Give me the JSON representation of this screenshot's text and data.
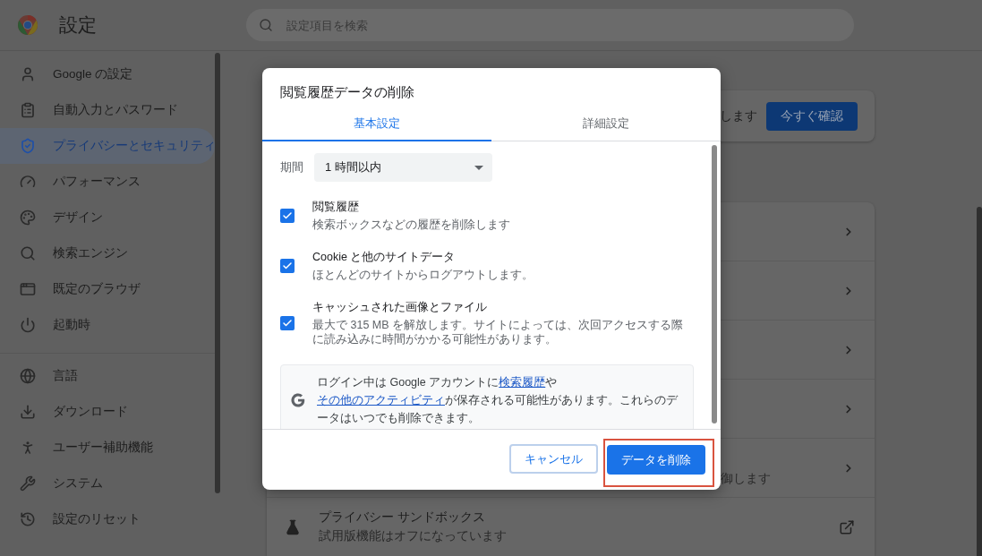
{
  "header": {
    "title": "設定",
    "search": {
      "placeholder": "設定項目を検索"
    }
  },
  "sidebar": {
    "groups": [
      [
        {
          "label": "Google の設定",
          "selected": false
        },
        {
          "label": "自動入力とパスワード",
          "selected": false
        },
        {
          "label": "プライバシーとセキュリティ",
          "selected": true
        },
        {
          "label": "パフォーマンス",
          "selected": false
        },
        {
          "label": "デザイン",
          "selected": false
        },
        {
          "label": "検索エンジン",
          "selected": false
        },
        {
          "label": "既定のブラウザ",
          "selected": false
        },
        {
          "label": "起動時",
          "selected": false
        }
      ],
      [
        {
          "label": "言語",
          "selected": false
        },
        {
          "label": "ダウンロード",
          "selected": false
        },
        {
          "label": "ユーザー補助機能",
          "selected": false
        },
        {
          "label": "システム",
          "selected": false
        },
        {
          "label": "設定のリセット",
          "selected": false
        }
      ]
    ]
  },
  "main": {
    "safety_card": {
      "text": "します",
      "button": "今すぐ確認"
    },
    "rows": [
      {
        "kind": "arrow"
      },
      {
        "kind": "arrow"
      },
      {
        "kind": "arrow"
      },
      {
        "kind": "arrow"
      },
      {
        "kind": "arrow",
        "subtitle": "御します"
      },
      {
        "kind": "external",
        "title": "プライバシー サンドボックス",
        "subtitle": "試用版機能はオフになっています"
      }
    ]
  },
  "dialog": {
    "title": "閲覧履歴データの削除",
    "tabs": [
      {
        "label": "基本設定",
        "selected": true
      },
      {
        "label": "詳細設定",
        "selected": false
      }
    ],
    "period": {
      "label": "期間",
      "value": "1 時間以内"
    },
    "items": [
      {
        "title": "閲覧履歴",
        "description": "検索ボックスなどの履歴を削除します",
        "checked": true
      },
      {
        "title": "Cookie と他のサイトデータ",
        "description": "ほとんどのサイトからログアウトします。",
        "checked": true
      },
      {
        "title": "キャッシュされた画像とファイル",
        "description": "最大で 315 MB を解放します。サイトによっては、次回アクセスする際に読み込みに時間がかかる可能性があります。",
        "checked": true
      }
    ],
    "info": {
      "parts": [
        {
          "kind": "text",
          "text": "ログイン中は Google アカウントに"
        },
        {
          "kind": "link",
          "text": "検索履歴"
        },
        {
          "kind": "text",
          "text": "や"
        },
        {
          "kind": "link",
          "text": "その他のアクティビティ"
        },
        {
          "kind": "text",
          "text": "が保存される可能性があります。これらのデータはいつでも削除できます。"
        }
      ]
    },
    "cancel_button": "キャンセル",
    "confirm_button": {
      "label": "データを削除",
      "highlighted": true
    }
  }
}
